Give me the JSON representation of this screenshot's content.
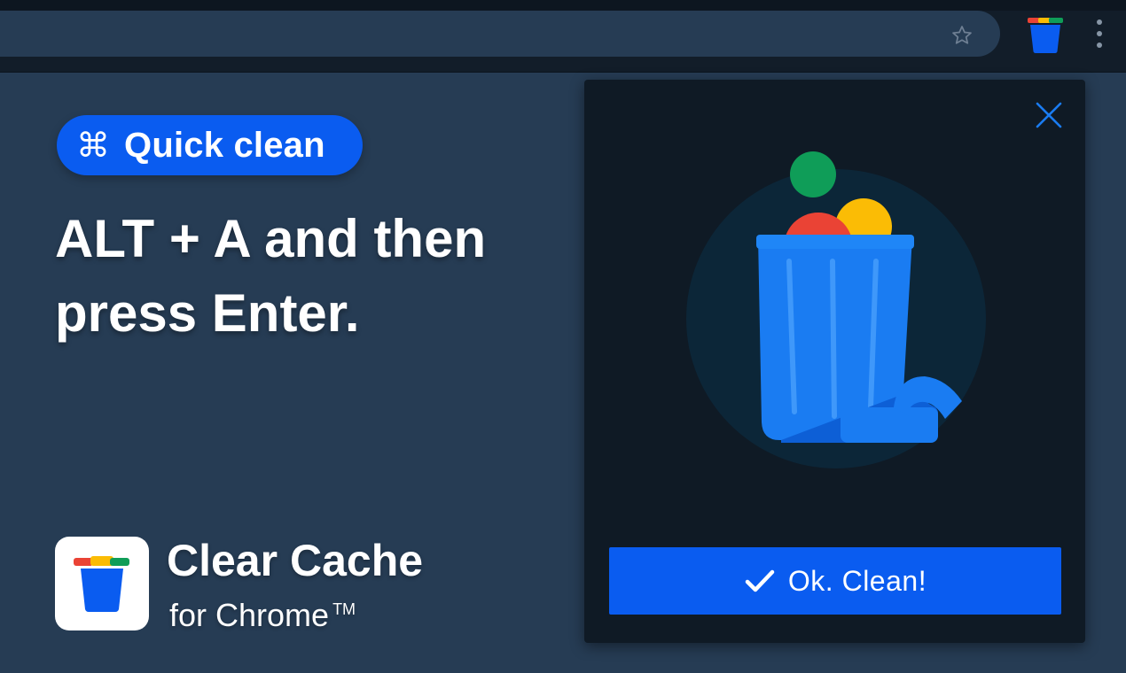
{
  "browser": {
    "star_icon": "star-icon",
    "extension_icon": "trash-bucket-icon",
    "menu_icon": "more-vert-icon"
  },
  "promo": {
    "badge_icon": "command-key-icon",
    "badge_label": "Quick clean",
    "headline": "ALT + A and then press Enter.",
    "product_name": "Clear Cache",
    "product_sub": "for Chrome",
    "product_tm": "TM"
  },
  "popup": {
    "close_icon": "close-icon",
    "illustration": "trash-can-illustration",
    "ok_label": "Ok. Clean!"
  },
  "colors": {
    "accent": "#0a5cf0",
    "background": "#263c54",
    "popup_bg": "#0f1a25",
    "bucket_blue": "#1a7cf2",
    "ball_green": "#0f9d58",
    "ball_yellow": "#fbbc05",
    "ball_red": "#ea4335"
  }
}
